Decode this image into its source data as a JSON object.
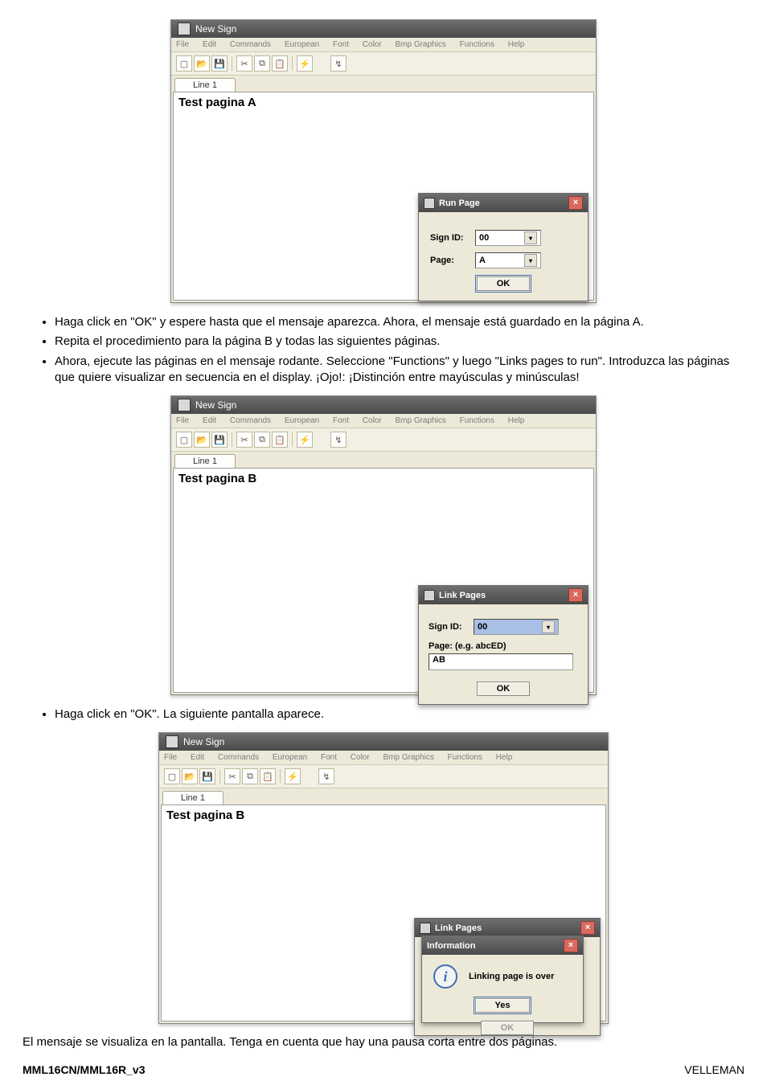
{
  "bullets_block1": [
    "Haga click en \"OK\" y espere hasta que el mensaje aparezca. Ahora, el mensaje está guardado en la página A.",
    "Repita el procedimiento para la página B y todas las siguientes páginas.",
    "Ahora, ejecute las páginas en el mensaje rodante. Seleccione \"Functions\" y luego \"Links pages to run\". Introduzca las páginas que quiere visualizar en secuencia en el display. ¡Ojo!: ¡Distinción entre mayúsculas y minúsculas!"
  ],
  "bullets_block2": [
    "Haga click en \"OK\". La siguiente pantalla aparece."
  ],
  "closing_text": "El mensaje se visualiza en la pantalla. Tenga en cuenta que hay una pausa corta entre dos páginas.",
  "footer": {
    "left": "MML16CN/MML16R_v3",
    "right": "VELLEMAN"
  },
  "app_common": {
    "title": "New Sign",
    "menu": [
      "File",
      "Edit",
      "Commands",
      "European",
      "Font",
      "Color",
      "Bmp Graphics",
      "Functions",
      "Help"
    ],
    "tab": "Line 1"
  },
  "fig1": {
    "editor_text": "Test pagina A",
    "dialog": {
      "title": "Run Page",
      "sign_id_label": "Sign ID:",
      "sign_id_value": "00",
      "page_label": "Page:",
      "page_value": "A",
      "ok": "OK"
    }
  },
  "fig2": {
    "editor_text": "Test pagina B",
    "dialog": {
      "title": "Link Pages",
      "sign_id_label": "Sign ID:",
      "sign_id_value": "00",
      "page_hint": "Page: (e.g. abcED)",
      "page_value": "AB",
      "ok": "OK"
    }
  },
  "fig3": {
    "editor_text": "Test pagina B",
    "dialog_back_title": "Link Pages",
    "info": {
      "title": "Information",
      "message": "Linking page is over",
      "yes": "Yes"
    },
    "ok_disabled": "OK"
  }
}
